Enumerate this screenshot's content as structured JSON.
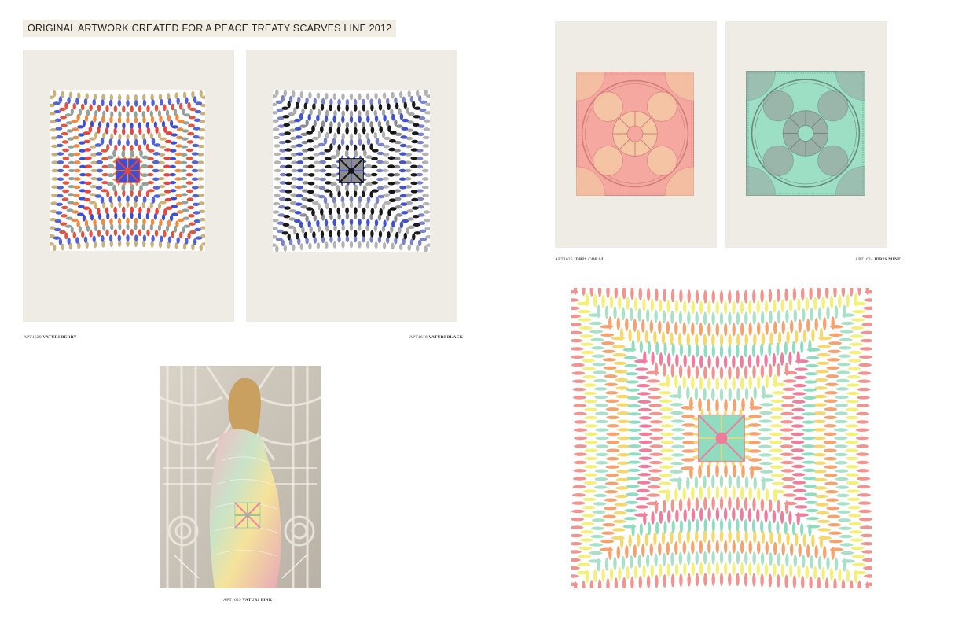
{
  "heading": "ORIGINAL ARTWORK CREATED FOR A PEACE TREATY SCARVES LINE 2012",
  "products": {
    "vaturi_berry": {
      "code": "APT1620",
      "name": "VATURI BERRY"
    },
    "vaturi_black": {
      "code": "APT1618",
      "name": "VATURI BLACK"
    },
    "idris_coral": {
      "code": "APT1625",
      "name": "IDRIS CORAL"
    },
    "idris_mint": {
      "code": "APT1624",
      "name": "IDRIS MINT"
    },
    "vaturi_pink": {
      "code": "APT1619",
      "name": "VATURI PINK"
    }
  },
  "palettes": {
    "berry": [
      "#e8443a",
      "#3b4fd0",
      "#f08a3e",
      "#8fa39a",
      "#e4533e",
      "#5163d8",
      "#c9b27a"
    ],
    "black": [
      "#151515",
      "#8c8c90",
      "#3f52cf",
      "#a6a6a6",
      "#1b1b1b",
      "#7a82c8",
      "#b3b3b3"
    ],
    "pink": [
      "#f07c9c",
      "#8fdcc0",
      "#f6d86a",
      "#f6a26f",
      "#a8e0c8",
      "#f3f07a",
      "#f2938f"
    ],
    "coral": {
      "bg": "#f4a8a0",
      "line": "#d27c76",
      "accent": "#f5d1a6"
    },
    "mint": {
      "bg": "#9ddfc5",
      "line": "#6b8a80",
      "accent": "#9aa5a0"
    }
  }
}
